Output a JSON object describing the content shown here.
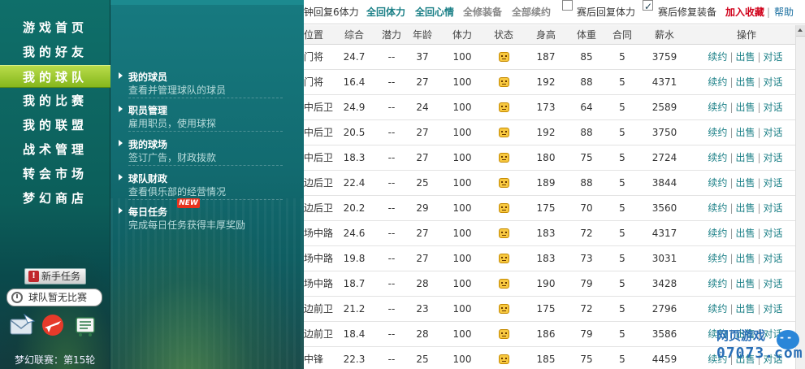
{
  "left_nav": {
    "items": [
      {
        "label": "游戏首页",
        "active": false
      },
      {
        "label": "我的好友",
        "active": false
      },
      {
        "label": "我的球队",
        "active": true
      },
      {
        "label": "我的比赛",
        "active": false
      },
      {
        "label": "我的联盟",
        "active": false
      },
      {
        "label": "战术管理",
        "active": false
      },
      {
        "label": "转会市场",
        "active": false
      },
      {
        "label": "梦幻商店",
        "active": false
      }
    ],
    "newbie_task": "新手任务",
    "match_status": "球队暂无比赛",
    "tool_icons": [
      "mail-icon",
      "airplane-icon",
      "cart-icon"
    ],
    "league_round": "梦幻联赛：第15轮"
  },
  "submenu": {
    "items": [
      {
        "title": "我的球员",
        "desc": "查看并管理球队的球员"
      },
      {
        "title": "职员管理",
        "desc": "雇用职员，使用球探"
      },
      {
        "title": "我的球场",
        "desc": "签订广告，财政拨款"
      },
      {
        "title": "球队财政",
        "desc": "查看俱乐部的经营情况"
      },
      {
        "title": "每日任务",
        "desc": "完成每日任务获得丰厚奖励",
        "badge": "NEW"
      }
    ]
  },
  "topbar": {
    "recover_text": "钟回复6体力",
    "full_stamina": "全回体力",
    "full_mood": "全回心情",
    "full_equip": "全修装备",
    "renew_all": "全部续约",
    "auto_recover": {
      "label": "赛后回复体力",
      "checked": false
    },
    "auto_repair": {
      "label": "赛后修复装备",
      "checked": true
    },
    "add_favorite": "加入收藏",
    "help": "帮助",
    "separator": "|"
  },
  "table": {
    "headers": [
      "位置",
      "综合",
      "潜力",
      "年龄",
      "体力",
      "状态",
      "身高",
      "体重",
      "合同",
      "薪水",
      "操作"
    ],
    "actions": {
      "renew": "续约",
      "sell": "出售",
      "talk": "对话",
      "pipe": "|"
    },
    "rows": [
      {
        "pos": "门将",
        "ovr": "24.7",
        "pot": "--",
        "age": "37",
        "sta": "100",
        "hgt": "187",
        "wgt": "85",
        "con": "5",
        "sal": "3759"
      },
      {
        "pos": "门将",
        "ovr": "16.4",
        "pot": "--",
        "age": "27",
        "sta": "100",
        "hgt": "192",
        "wgt": "88",
        "con": "5",
        "sal": "4371"
      },
      {
        "pos": "中后卫",
        "ovr": "24.9",
        "pot": "--",
        "age": "24",
        "sta": "100",
        "hgt": "173",
        "wgt": "64",
        "con": "5",
        "sal": "2589"
      },
      {
        "pos": "中后卫",
        "ovr": "20.5",
        "pot": "--",
        "age": "27",
        "sta": "100",
        "hgt": "192",
        "wgt": "88",
        "con": "5",
        "sal": "3750"
      },
      {
        "pos": "中后卫",
        "ovr": "18.3",
        "pot": "--",
        "age": "27",
        "sta": "100",
        "hgt": "180",
        "wgt": "75",
        "con": "5",
        "sal": "2724"
      },
      {
        "pos": "边后卫",
        "ovr": "22.4",
        "pot": "--",
        "age": "25",
        "sta": "100",
        "hgt": "189",
        "wgt": "88",
        "con": "5",
        "sal": "3844"
      },
      {
        "pos": "边后卫",
        "ovr": "20.2",
        "pot": "--",
        "age": "29",
        "sta": "100",
        "hgt": "175",
        "wgt": "70",
        "con": "5",
        "sal": "3560"
      },
      {
        "pos": "场中路",
        "ovr": "24.6",
        "pot": "--",
        "age": "27",
        "sta": "100",
        "hgt": "183",
        "wgt": "72",
        "con": "5",
        "sal": "4317"
      },
      {
        "pos": "场中路",
        "ovr": "19.8",
        "pot": "--",
        "age": "27",
        "sta": "100",
        "hgt": "183",
        "wgt": "73",
        "con": "5",
        "sal": "3031"
      },
      {
        "pos": "场中路",
        "ovr": "18.7",
        "pot": "--",
        "age": "28",
        "sta": "100",
        "hgt": "190",
        "wgt": "79",
        "con": "5",
        "sal": "3428"
      },
      {
        "pos": "边前卫",
        "ovr": "21.2",
        "pot": "--",
        "age": "23",
        "sta": "100",
        "hgt": "175",
        "wgt": "72",
        "con": "5",
        "sal": "2796"
      },
      {
        "pos": "边前卫",
        "ovr": "18.4",
        "pot": "--",
        "age": "28",
        "sta": "100",
        "hgt": "186",
        "wgt": "79",
        "con": "5",
        "sal": "3586"
      },
      {
        "pos": "中锋",
        "ovr": "22.3",
        "pot": "--",
        "age": "25",
        "sta": "100",
        "hgt": "185",
        "wgt": "75",
        "con": "5",
        "sal": "4459"
      }
    ]
  },
  "watermark": {
    "top": "网页游戏",
    "bottom": "07073.com"
  }
}
